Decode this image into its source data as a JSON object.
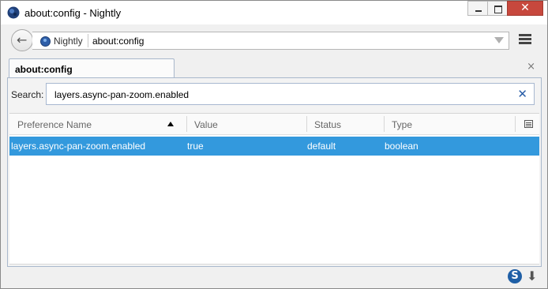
{
  "window": {
    "title": "about:config - Nightly"
  },
  "caption_buttons": {
    "close_glyph": "✕"
  },
  "navbar": {
    "back_glyph": "←",
    "identity_label": "Nightly",
    "url": "about:config"
  },
  "tabs": [
    {
      "label": "about:config",
      "selected": true
    }
  ],
  "tabstrip": {
    "close_glyph": "×"
  },
  "search": {
    "label": "Search:",
    "value": "layers.async-pan-zoom.enabled",
    "clear_glyph": "✕"
  },
  "table": {
    "columns": [
      "Preference Name",
      "Value",
      "Status",
      "Type"
    ],
    "sort_column": "Preference Name",
    "sort_direction": "ascending",
    "rows": [
      {
        "name": "layers.async-pan-zoom.enabled",
        "value": "true",
        "status": "default",
        "type": "boolean",
        "selected": true
      }
    ]
  },
  "addonbar": {
    "s_glyph": "S",
    "download_glyph": "⬇"
  },
  "colors": {
    "selection": "#3399dd",
    "close_button": "#c7483d",
    "link_blue": "#2a5ea8"
  }
}
